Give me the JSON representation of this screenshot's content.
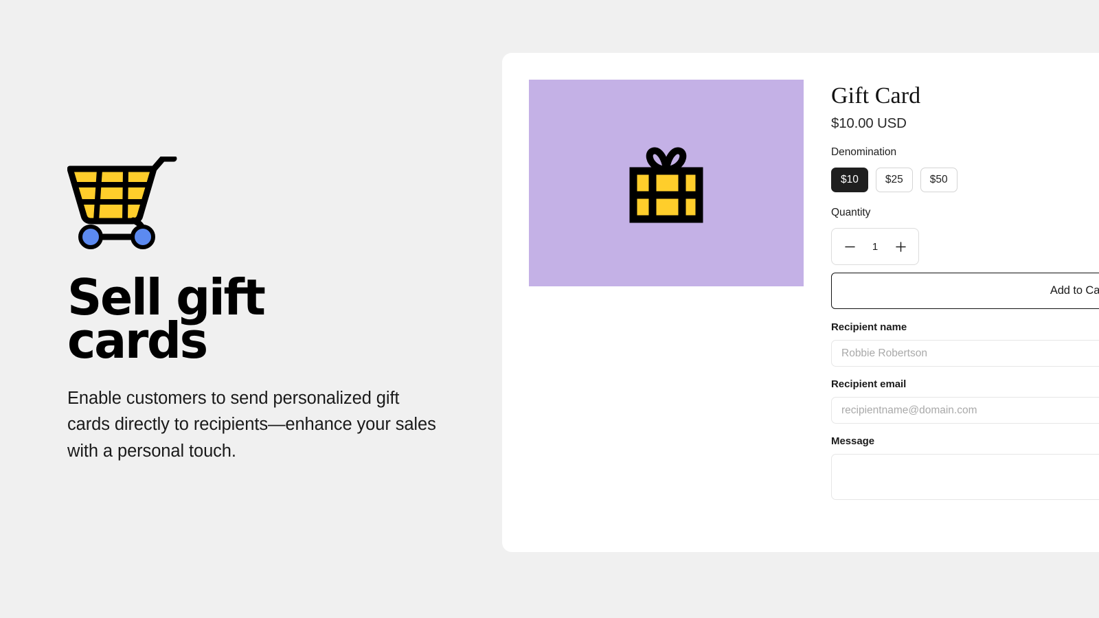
{
  "page": {
    "background_color": "#f0f0f0",
    "card_background_color": "#ffffff"
  },
  "promo": {
    "icon": "shopping-cart-icon",
    "icon_colors": {
      "basket": "#ffce2b",
      "wheels": "#5c8af0",
      "outline": "#000000"
    },
    "heading": "Sell gift cards",
    "body": "Enable customers to send personalized gift cards directly to recipients—enhance your sales with a personal touch."
  },
  "product": {
    "media": {
      "icon": "gift-box-icon",
      "background_color": "#c4b1e6",
      "box_color": "#ffce2b",
      "outline_color": "#000000"
    },
    "title": "Gift Card",
    "price": "$10.00 USD",
    "denomination": {
      "label": "Denomination",
      "options": [
        {
          "label": "$10",
          "selected": true
        },
        {
          "label": "$25",
          "selected": false
        },
        {
          "label": "$50",
          "selected": false
        }
      ],
      "selected_color": "#1f1f1f"
    },
    "quantity": {
      "label": "Quantity",
      "value": "1",
      "decrement_icon": "minus-icon",
      "increment_icon": "plus-icon"
    },
    "add_to_cart_label": "Add to Cart",
    "form": {
      "recipient_name": {
        "label": "Recipient name",
        "value": "",
        "placeholder": "Robbie Robertson"
      },
      "recipient_email": {
        "label": "Recipient email",
        "value": "",
        "placeholder": "recipientname@domain.com"
      },
      "message": {
        "label": "Message",
        "value": "",
        "placeholder": ""
      }
    }
  }
}
